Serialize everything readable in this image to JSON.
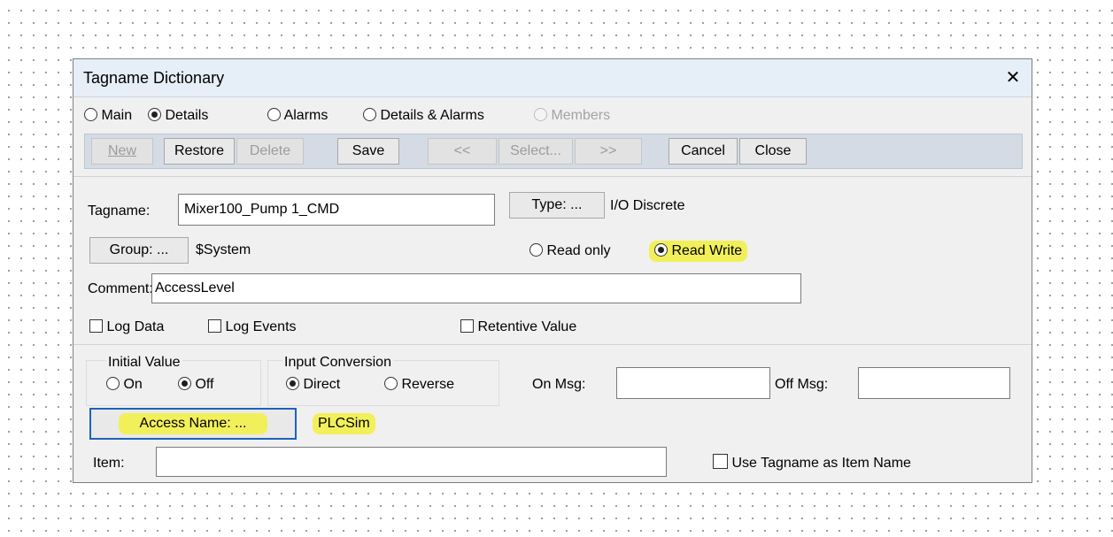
{
  "dialog": {
    "title": "Tagname Dictionary",
    "close_glyph": "✕"
  },
  "view_options": [
    {
      "label": "Main",
      "checked": false,
      "enabled": true
    },
    {
      "label": "Details",
      "checked": true,
      "enabled": true
    },
    {
      "label": "Alarms",
      "checked": false,
      "enabled": true
    },
    {
      "label": "Details & Alarms",
      "checked": false,
      "enabled": true
    },
    {
      "label": "Members",
      "checked": false,
      "enabled": false
    }
  ],
  "toolbar": {
    "new": "New",
    "restore": "Restore",
    "delete": "Delete",
    "save": "Save",
    "prev": "<<",
    "select": "Select...",
    "next": ">>",
    "cancel": "Cancel",
    "close": "Close"
  },
  "tag": {
    "tagname_label": "Tagname:",
    "tagname_value": "Mixer100_Pump 1_CMD",
    "type_button": "Type: ...",
    "type_value": "I/O Discrete",
    "group_button": "Group: ...",
    "group_value": "$System",
    "read_only_label": "Read only",
    "read_write_label": "Read Write",
    "access_mode": "Read Write",
    "comment_label": "Comment:",
    "comment_value": "AccessLevel"
  },
  "checkboxes": {
    "log_data": "Log Data",
    "log_events": "Log Events",
    "retentive_value": "Retentive Value",
    "use_tagname": "Use Tagname as Item Name"
  },
  "initial_value": {
    "title": "Initial Value",
    "on": "On",
    "off": "Off",
    "selected": "Off"
  },
  "input_conversion": {
    "title": "Input Conversion",
    "direct": "Direct",
    "reverse": "Reverse",
    "selected": "Direct"
  },
  "messages": {
    "on_msg_label": "On Msg:",
    "on_msg_value": "",
    "off_msg_label": "Off Msg:",
    "off_msg_value": ""
  },
  "access": {
    "button": "Access Name: ...",
    "value": "PLCSim"
  },
  "item": {
    "label": "Item:",
    "value": ""
  },
  "colors": {
    "highlight": "#f2f05a",
    "focus_border": "#1e63b8",
    "titlebar": "#e6eef7",
    "dialog_bg": "#f0f0f0"
  }
}
